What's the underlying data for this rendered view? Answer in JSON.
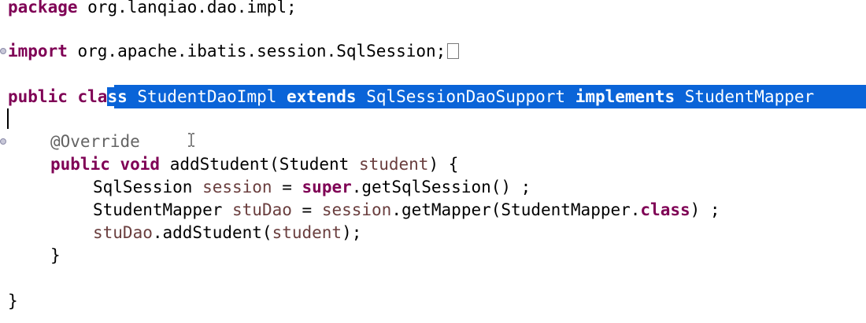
{
  "editor": {
    "line1": {
      "kw": "package",
      "rest": " org.lanqiao.dao.impl;"
    },
    "line2": {
      "kw": "import",
      "rest": " org.apache.ibatis.session.SqlSession;"
    },
    "line3": {
      "kw_public": "public",
      "kw_cla": " cla",
      "sel_ss": "ss",
      "sel_name": " StudentDaoImpl ",
      "sel_extends": "extends",
      "sel_super": " SqlSessionDaoSupport ",
      "sel_implements": "implements",
      "sel_iface": " StudentMapper"
    },
    "line5": {
      "annotation": "@Override"
    },
    "line6": {
      "kw_public": "public",
      "kw_void": " void",
      "method": " addStudent(Student ",
      "param": "student",
      "end": ") {"
    },
    "line7": {
      "type": "SqlSession ",
      "var": "session",
      "eq": " = ",
      "kw_super": "super",
      "call": ".getSqlSession() ;"
    },
    "line8": {
      "type": "StudentMapper ",
      "var": "stuDao",
      "eq": " = ",
      "var2": "session",
      "call": ".getMapper(StudentMapper.",
      "kw_class": "class",
      "end": ") ;"
    },
    "line9": {
      "var": "stuDao",
      "call": ".addStudent(",
      "param": "student",
      "end": ");"
    },
    "line10": {
      "brace": "}"
    },
    "line12": {
      "brace": "}"
    }
  },
  "colors": {
    "keyword": "#7f0055",
    "variable": "#6a3e3e",
    "annotation": "#646464",
    "selection": "#0a64d8"
  }
}
